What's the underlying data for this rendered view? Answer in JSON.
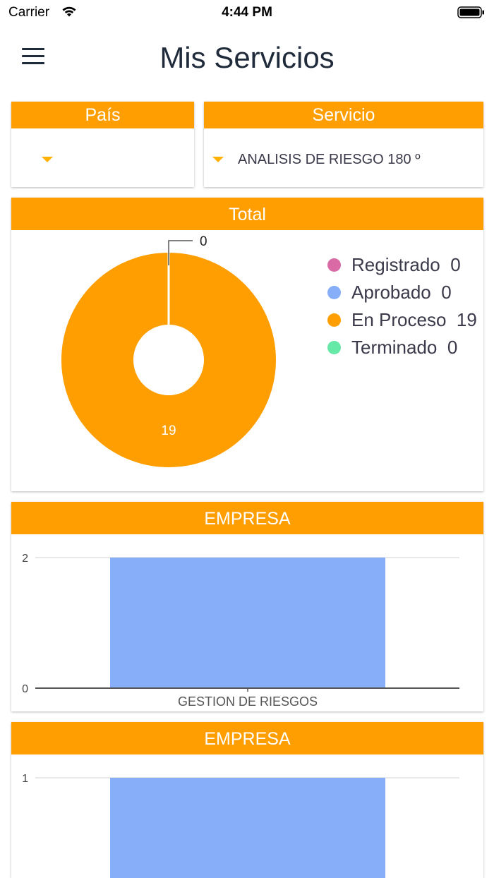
{
  "status_bar": {
    "carrier": "Carrier",
    "time": "4:44 PM"
  },
  "header": {
    "title": "Mis Servicios",
    "menu_icon": "hamburger-menu-icon"
  },
  "filters": {
    "pais": {
      "label": "País",
      "value": ""
    },
    "servicio": {
      "label": "Servicio",
      "value": "ANALISIS DE RIESGO 180 º"
    }
  },
  "total_card": {
    "title": "Total",
    "legend": [
      {
        "label": "Registrado",
        "count": "0",
        "color": "#d96aa6"
      },
      {
        "label": "Aprobado",
        "count": "0",
        "color": "#87aef9"
      },
      {
        "label": "En Proceso",
        "count": "19",
        "color": "#ff9e00"
      },
      {
        "label": "Terminado",
        "count": "0",
        "color": "#66e8a7"
      }
    ]
  },
  "empresa_card_1": {
    "title": "EMPRESA"
  },
  "empresa_card_2": {
    "title": "EMPRESA"
  },
  "chart_data": [
    {
      "type": "pie",
      "subtype": "donut",
      "title": "Total",
      "categories": [
        "Registrado",
        "Aprobado",
        "En Proceso",
        "Terminado"
      ],
      "values": [
        0,
        0,
        19,
        0
      ],
      "colors": [
        "#d96aa6",
        "#87aef9",
        "#ff9e00",
        "#66e8a7"
      ],
      "data_labels": [
        "0",
        "19"
      ],
      "legend": "right"
    },
    {
      "type": "bar",
      "title": "EMPRESA",
      "categories": [
        "GESTION DE RIESGOS"
      ],
      "values": [
        2
      ],
      "ylim": [
        0,
        2
      ],
      "yticks": [
        "0",
        "2"
      ],
      "color": "#87aef9",
      "grid": true
    },
    {
      "type": "bar",
      "title": "EMPRESA",
      "categories": [
        ""
      ],
      "values": [
        1
      ],
      "ylim": [
        0,
        1
      ],
      "yticks": [
        "1"
      ],
      "color": "#87aef9",
      "grid": true
    }
  ]
}
